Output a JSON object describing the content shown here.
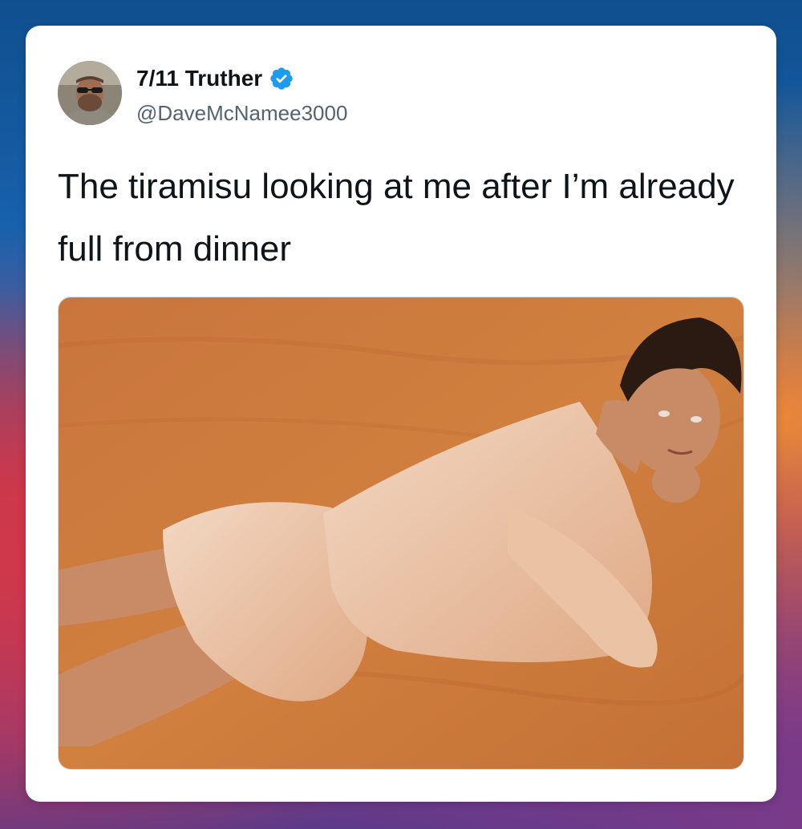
{
  "tweet": {
    "display_name": "7/11 Truther",
    "handle": "@DaveMcNamee3000",
    "verified": true,
    "text": "The tiramisu looking at me after I’m already full from dinner"
  },
  "icons": {
    "verified": "verified-badge-icon",
    "avatar": "profile-photo"
  },
  "colors": {
    "verified_blue": "#1d9bf0",
    "text_primary": "#0f1419",
    "text_secondary": "#536471",
    "card_bg": "#ffffff"
  }
}
